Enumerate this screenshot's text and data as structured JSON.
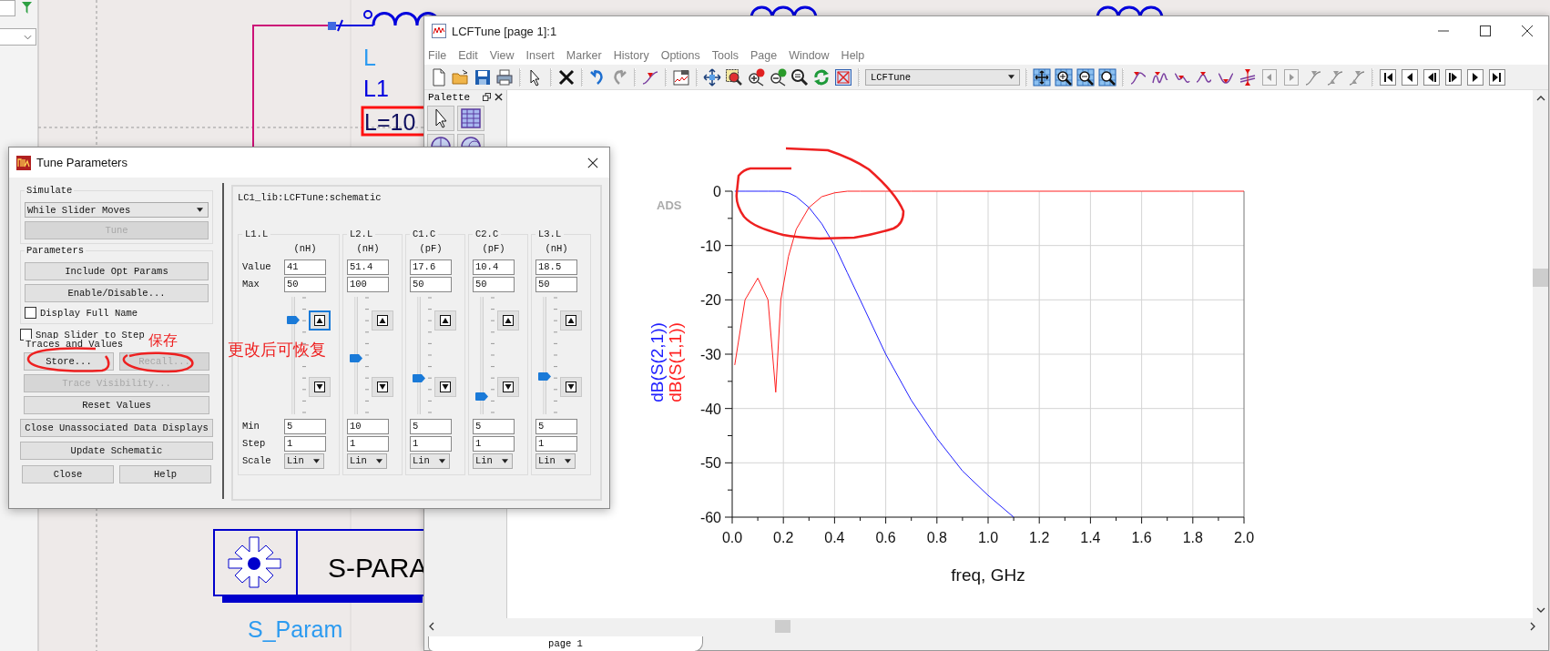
{
  "schematic": {
    "component_label": "L",
    "instance_name": "L1",
    "parameter": "L=10",
    "sim_box_title": "S-PARA",
    "sim_name": "S_Param"
  },
  "plot_window": {
    "title": "LCFTune [page 1]:1",
    "menu": [
      "File",
      "Edit",
      "View",
      "Insert",
      "Marker",
      "History",
      "Options",
      "Tools",
      "Page",
      "Window",
      "Help"
    ],
    "toolbar_dropdown": "LCFTune",
    "palette_title": "Palette",
    "logo": "ADS",
    "page_tab": "page 1",
    "chart_data": {
      "type": "line",
      "grid": true,
      "xlabel": "freq, GHz",
      "x": [
        0.01,
        0.05,
        0.1,
        0.14,
        0.17,
        0.19,
        0.22,
        0.25,
        0.3,
        0.35,
        0.4,
        0.45,
        0.5,
        0.6,
        0.7,
        0.8,
        0.9,
        1.0,
        1.1,
        1.2,
        1.4,
        1.6,
        1.75,
        2.0
      ],
      "series": [
        {
          "name": "dB(S(2,1))",
          "color": "#2020ff",
          "values": [
            0,
            0,
            0,
            0,
            0,
            0,
            -0.3,
            -1,
            -3,
            -6,
            -10,
            -15,
            -20,
            -30,
            -38.5,
            -45.5,
            -51.5,
            -56,
            -60,
            null,
            null,
            null,
            null,
            null
          ]
        },
        {
          "name": "dB(S(1,1))",
          "color": "#ff2020",
          "values": [
            -32,
            -20,
            -16,
            -20,
            -37,
            -20,
            -12,
            -7,
            -3,
            -1,
            -0.3,
            0,
            0,
            0,
            0,
            0,
            0,
            0,
            0,
            0,
            0,
            0,
            0,
            0
          ]
        }
      ],
      "xlim": [
        0,
        2
      ],
      "ylim": [
        -60,
        0
      ],
      "xticks": [
        {
          "value": 0,
          "label": "0.0"
        },
        {
          "value": 0.2,
          "label": "0.2"
        },
        {
          "value": 0.4,
          "label": "0.4"
        },
        {
          "value": 0.6,
          "label": "0.6"
        },
        {
          "value": 0.8,
          "label": "0.8"
        },
        {
          "value": 1,
          "label": "1.0"
        },
        {
          "value": 1.2,
          "label": "1.2"
        },
        {
          "value": 1.4,
          "label": "1.4"
        },
        {
          "value": 1.6,
          "label": "1.6"
        },
        {
          "value": 1.8,
          "label": "1.8"
        },
        {
          "value": 2,
          "label": "2.0"
        }
      ],
      "yticks": [
        0,
        -10,
        -20,
        -30,
        -40,
        -50,
        -60
      ]
    }
  },
  "tune_dialog": {
    "title": "Tune Parameters",
    "simulate_label": "Simulate",
    "simulate_mode": "While Slider Moves",
    "tune_button": {
      "label": "Tune",
      "disabled": true
    },
    "parameters_label": "Parameters",
    "parameter_buttons": [
      "Include Opt Params",
      "Enable/Disable..."
    ],
    "display_full_name": {
      "label": "Display Full Name",
      "checked": false
    },
    "snap_slider": {
      "label": "Snap Slider to Step",
      "checked": false
    },
    "traces_label": "Traces and Values",
    "trace_buttons": [
      {
        "label": "Store...",
        "disabled": false
      },
      {
        "label": "Recall...",
        "disabled": true
      }
    ],
    "trace_visibility": {
      "label": "Trace Visibility...",
      "disabled": true
    },
    "reset_button": "Reset Values",
    "close_unassociated_button": "Close Unassociated Data Displays",
    "update_button": "Update Schematic",
    "close_button": "Close",
    "help_button": "Help",
    "schematic_name": "LC1_lib:LCFTune:schematic",
    "row_labels": {
      "value": "Value",
      "max": "Max",
      "min": "Min",
      "step": "Step",
      "scale": "Scale"
    },
    "params": [
      {
        "name": "L1.L",
        "unit": "(nH)",
        "value": "41",
        "max": "50",
        "min": "5",
        "step": "1",
        "scale": "Lin",
        "level": 0.8,
        "selected": true
      },
      {
        "name": "L2.L",
        "unit": "(nH)",
        "value": "51.4",
        "max": "100",
        "min": "10",
        "step": "1",
        "scale": "Lin",
        "level": 0.46,
        "selected": false
      },
      {
        "name": "C1.C",
        "unit": "(pF)",
        "value": "17.6",
        "max": "50",
        "min": "5",
        "step": "1",
        "scale": "Lin",
        "level": 0.28,
        "selected": false
      },
      {
        "name": "C2.C",
        "unit": "(pF)",
        "value": "10.4",
        "max": "50",
        "min": "5",
        "step": "1",
        "scale": "Lin",
        "level": 0.12,
        "selected": false
      },
      {
        "name": "L3.L",
        "unit": "(nH)",
        "value": "18.5",
        "max": "50",
        "min": "5",
        "step": "1",
        "scale": "Lin",
        "level": 0.3,
        "selected": false
      }
    ]
  },
  "annotations": [
    {
      "text": "保存"
    },
    {
      "text": "更改后可恢复"
    }
  ]
}
